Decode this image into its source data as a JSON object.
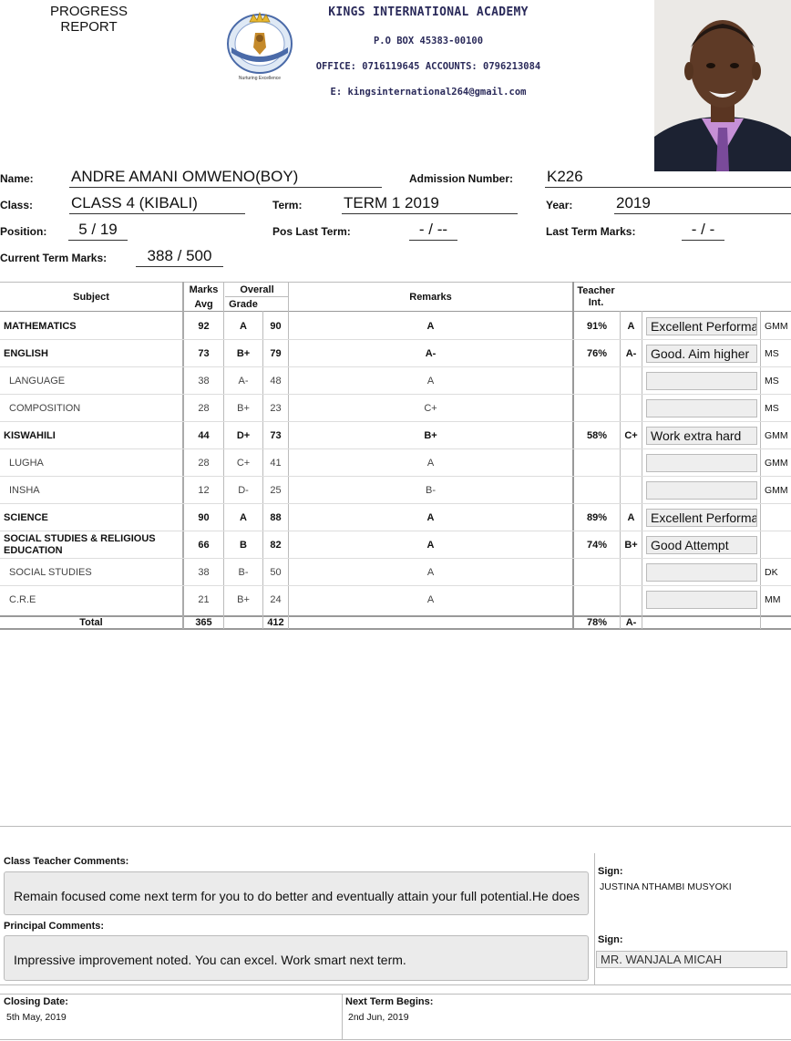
{
  "header": {
    "report_title": "PROGRESS REPORT",
    "school_name": "KINGS INTERNATIONAL ACADEMY",
    "po_box": "P.O BOX 45383-00100",
    "phones": "OFFICE: 0716119645 ACCOUNTS: 0796213084",
    "email": "E: kingsinternational264@gmail.com",
    "logo_top": "Kings",
    "logo_right": "Academy",
    "logo_band": "International",
    "logo_motto": "Nurturing Excellence"
  },
  "student": {
    "name_label": "Name:",
    "name": "ANDRE AMANI OMWENO(BOY)",
    "admission_label": "Admission Number:",
    "admission": "K226",
    "class_label": "Class:",
    "class": "CLASS 4 (KIBALI)",
    "term_label": "Term:",
    "term": "TERM 1 2019",
    "year_label": "Year:",
    "year": "2019",
    "position_label": "Position:",
    "position": "5 / 19",
    "pos_last_label": "Pos Last Term:",
    "pos_last": "- / --",
    "last_marks_label": "Last Term Marks:",
    "last_marks": "- / -",
    "current_marks_label": "Current Term Marks:",
    "current_marks": "388 / 500"
  },
  "table": {
    "headers": {
      "subject": "Subject",
      "marks": "Marks",
      "overall": "Overall",
      "avg": "Avg",
      "grade": "Grade",
      "remarks": "Remarks",
      "teacher": "Teacher",
      "int": "Int."
    },
    "rows": [
      {
        "subject": "MATHEMATICS",
        "main": true,
        "marks": "92",
        "grade": "A",
        "avg": "90",
        "remark": "A",
        "pct": "91%",
        "g2": "A",
        "comment": "Excellent Performance",
        "initials": "GMM"
      },
      {
        "subject": "ENGLISH",
        "main": true,
        "marks": "73",
        "grade": "B+",
        "avg": "79",
        "remark": "A-",
        "pct": "76%",
        "g2": "A-",
        "comment": "Good. Aim higher",
        "initials": "MS"
      },
      {
        "subject": "LANGUAGE",
        "main": false,
        "marks": "38",
        "grade": "A-",
        "avg": "48",
        "remark": "A",
        "pct": "",
        "g2": "",
        "comment": "",
        "initials": "MS"
      },
      {
        "subject": "COMPOSITION",
        "main": false,
        "marks": "28",
        "grade": "B+",
        "avg": "23",
        "remark": "C+",
        "pct": "",
        "g2": "",
        "comment": "",
        "initials": "MS"
      },
      {
        "subject": "KISWAHILI",
        "main": true,
        "marks": "44",
        "grade": "D+",
        "avg": "73",
        "remark": "B+",
        "pct": "58%",
        "g2": "C+",
        "comment": "Work extra hard",
        "initials": "GMM"
      },
      {
        "subject": "LUGHA",
        "main": false,
        "marks": "28",
        "grade": "C+",
        "avg": "41",
        "remark": "A",
        "pct": "",
        "g2": "",
        "comment": "",
        "initials": "GMM"
      },
      {
        "subject": "INSHA",
        "main": false,
        "marks": "12",
        "grade": "D-",
        "avg": "25",
        "remark": "B-",
        "pct": "",
        "g2": "",
        "comment": "",
        "initials": "GMM"
      },
      {
        "subject": "SCIENCE",
        "main": true,
        "marks": "90",
        "grade": "A",
        "avg": "88",
        "remark": "A",
        "pct": "89%",
        "g2": "A",
        "comment": "Excellent Performance",
        "initials": ""
      },
      {
        "subject": "SOCIAL STUDIES & RELIGIOUS EDUCATION",
        "main": true,
        "marks": "66",
        "grade": "B",
        "avg": "82",
        "remark": "A",
        "pct": "74%",
        "g2": "B+",
        "comment": "Good Attempt",
        "initials": ""
      },
      {
        "subject": "SOCIAL STUDIES",
        "main": false,
        "marks": "38",
        "grade": "B-",
        "avg": "50",
        "remark": "A",
        "pct": "",
        "g2": "",
        "comment": "",
        "initials": "DK"
      },
      {
        "subject": "C.R.E",
        "main": false,
        "marks": "21",
        "grade": "B+",
        "avg": "24",
        "remark": "A",
        "pct": "",
        "g2": "",
        "comment": "",
        "initials": "MM"
      }
    ],
    "total": {
      "label": "Total",
      "marks": "365",
      "avg": "412",
      "pct": "78%",
      "g2": "A-"
    }
  },
  "comments": {
    "class_teacher_label": "Class Teacher Comments:",
    "class_teacher_text": "Remain focused come next term for you to do better and eventually attain your full potential.He does",
    "sign_label": "Sign:",
    "class_teacher_sign": "JUSTINA NTHAMBI MUSYOKI",
    "principal_label": "Principal Comments:",
    "principal_text": "Impressive improvement noted. You can excel. Work smart next term.",
    "principal_sign": "MR. WANJALA MICAH"
  },
  "footer": {
    "closing_label": "Closing Date:",
    "closing_date": "5th May, 2019",
    "next_term_label": "Next Term Begins:",
    "next_term_date": "2nd Jun, 2019"
  }
}
